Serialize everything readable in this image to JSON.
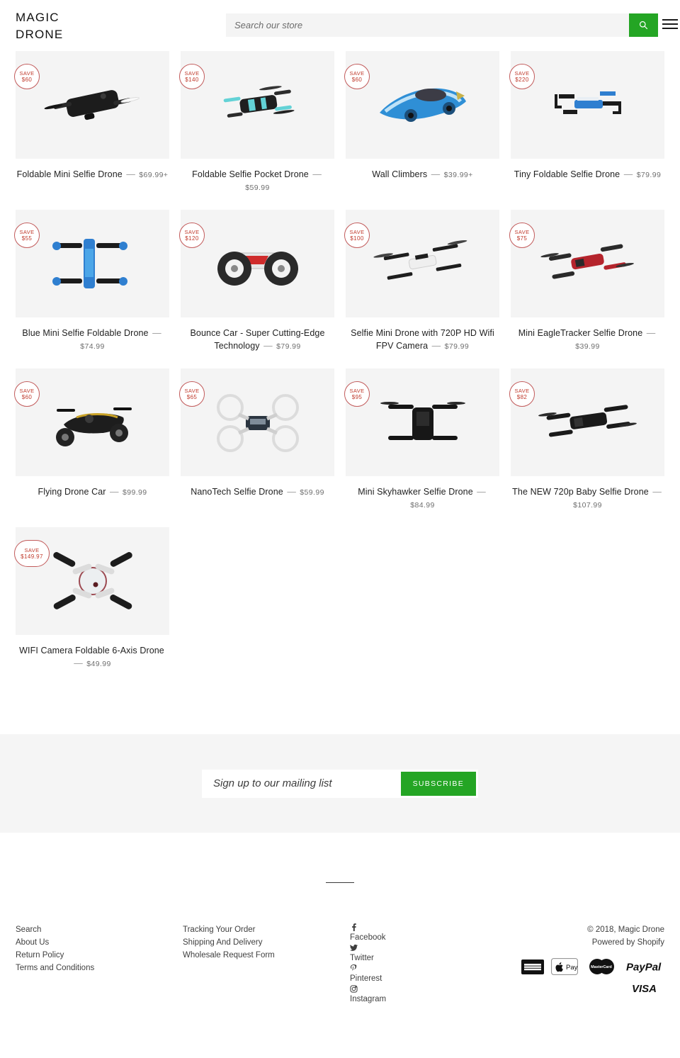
{
  "header": {
    "logo_line1": "MAGIC",
    "logo_line2": "DRONE",
    "search_placeholder": "Search our store",
    "search_value": "",
    "search_icon": "search-icon",
    "menu_icon": "hamburger-menu-icon"
  },
  "products": [
    {
      "badge_label": "SAVE",
      "badge_amount": "$60",
      "title": "Foldable Mini Selfie Drone",
      "dash": "—",
      "price": "$69.99+",
      "image": "black-foldable-selfie-drone"
    },
    {
      "badge_label": "SAVE",
      "badge_amount": "$140",
      "title": "Foldable Selfie Pocket Drone",
      "dash": "—",
      "price": "$59.99",
      "image": "black-teal-pocket-drone"
    },
    {
      "badge_label": "SAVE",
      "badge_amount": "$60",
      "title": "Wall Climbers",
      "dash": "—",
      "price": "$39.99+",
      "image": "blue-wall-climber-car"
    },
    {
      "badge_label": "SAVE",
      "badge_amount": "$220",
      "title": "Tiny Foldable Selfie Drone",
      "dash": "—",
      "price": "$79.99",
      "image": "blue-tiny-foldable-drone"
    },
    {
      "badge_label": "SAVE",
      "badge_amount": "$55",
      "title": "Blue Mini Selfie Foldable Drone",
      "dash": "—",
      "price": "$74.99",
      "image": "blue-mini-foldable-drone"
    },
    {
      "badge_label": "SAVE",
      "badge_amount": "$120",
      "title": "Bounce Car - Super Cutting-Edge Technology",
      "dash": "—",
      "price": "$79.99",
      "image": "white-bounce-car"
    },
    {
      "badge_label": "SAVE",
      "badge_amount": "$100",
      "title": "Selfie Mini Drone with 720P HD Wifi FPV Camera",
      "dash": "—",
      "price": "$79.99",
      "image": "white-mini-fpv-drone"
    },
    {
      "badge_label": "SAVE",
      "badge_amount": "$75",
      "title": "Mini EagleTracker Selfie Drone",
      "dash": "—",
      "price": "$39.99",
      "image": "red-eagletracker-drone"
    },
    {
      "badge_label": "SAVE",
      "badge_amount": "$60",
      "title": "Flying Drone Car",
      "dash": "—",
      "price": "$99.99",
      "image": "black-gold-flying-drone-car"
    },
    {
      "badge_label": "SAVE",
      "badge_amount": "$65",
      "title": "NanoTech Selfie Drone",
      "dash": "—",
      "price": "$59.99",
      "image": "white-nanotech-quadcopter"
    },
    {
      "badge_label": "SAVE",
      "badge_amount": "$95",
      "title": "Mini Skyhawker Selfie Drone",
      "dash": "—",
      "price": "$84.99",
      "image": "black-skyhawker-drone"
    },
    {
      "badge_label": "SAVE",
      "badge_amount": "$82",
      "title": "The NEW 720p Baby Selfie Drone",
      "dash": "—",
      "price": "$107.99",
      "image": "black-baby-selfie-drone"
    },
    {
      "badge_label": "SAVE",
      "badge_amount": "$149.97",
      "title": "WIFI Camera Foldable 6-Axis Drone",
      "dash": "—",
      "price": "$49.99",
      "image": "white-6axis-wifi-drone",
      "badge_wide": true
    }
  ],
  "newsletter": {
    "placeholder": "Sign up to our mailing list",
    "value": "",
    "subscribe_label": "SUBSCRIBE"
  },
  "footer": {
    "links_col1": [
      "Search",
      "About Us",
      "Return Policy",
      "Terms and Conditions"
    ],
    "links_col2": [
      "Tracking Your Order",
      "Shipping And Delivery",
      "Wholesale Request Form"
    ],
    "social": [
      {
        "label": "Facebook",
        "icon": "facebook-icon"
      },
      {
        "label": "Twitter",
        "icon": "twitter-icon"
      },
      {
        "label": "Pinterest",
        "icon": "pinterest-icon"
      },
      {
        "label": "Instagram",
        "icon": "instagram-icon"
      }
    ],
    "copyright": "© 2018, Magic Drone",
    "powered_by": "Powered by Shopify",
    "payments_row1": [
      "American Express",
      "Apple Pay",
      "MasterCard",
      "PayPal"
    ],
    "payments_row2": [
      "VISA"
    ]
  },
  "colors": {
    "accent_green": "#24a524",
    "badge_red": "#c0392b",
    "tile_gray": "#f4f4f4",
    "band_gray": "#f5f5f5"
  }
}
